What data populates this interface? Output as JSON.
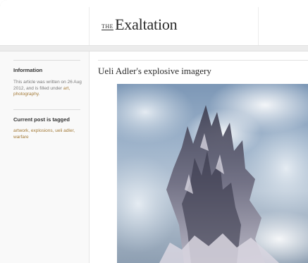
{
  "site": {
    "logo_prefix": "THE",
    "logo_name": "Exaltation"
  },
  "sidebar": {
    "info_heading": "Information",
    "info_text_before": "This article was written on 26 Aug 2012, and is filled under ",
    "info_categories": "art, photography",
    "info_text_after": ".",
    "tags_heading": "Current post is tagged",
    "tags_text": "artwork, explosions, ueli adler, warfare"
  },
  "article": {
    "title": "Ueli Adler's explosive imagery",
    "image_icon": "explosion-artwork-image"
  },
  "colors": {
    "link": "#a37a38",
    "text": "#2b2b2b",
    "sidebar_bg": "#f9f9f9"
  }
}
